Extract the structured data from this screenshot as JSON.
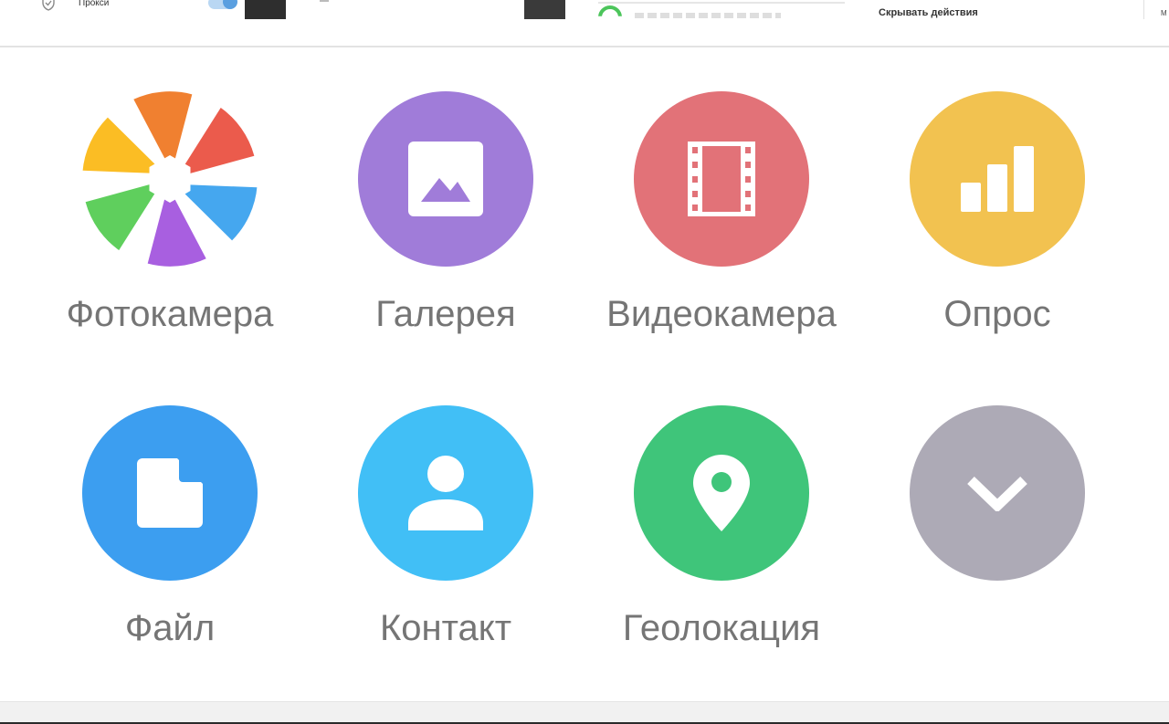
{
  "top_strip": {
    "proxy_label": "Прокси",
    "hide_actions_label": "Скрывать действия",
    "right_fragment": "М"
  },
  "attach_menu": {
    "items": [
      {
        "id": "camera",
        "label": "Фотокамера",
        "icon": "camera-shutter-icon",
        "color": "multicolor"
      },
      {
        "id": "gallery",
        "label": "Галерея",
        "icon": "image-icon",
        "color": "#a07cd9"
      },
      {
        "id": "video",
        "label": "Видеокамера",
        "icon": "film-strip-icon",
        "color": "#e27278"
      },
      {
        "id": "poll",
        "label": "Опрос",
        "icon": "bar-chart-icon",
        "color": "#f2c250"
      },
      {
        "id": "file",
        "label": "Файл",
        "icon": "file-icon",
        "color": "#3c9ef0"
      },
      {
        "id": "contact",
        "label": "Контакт",
        "icon": "person-icon",
        "color": "#41bff6"
      },
      {
        "id": "location",
        "label": "Геолокация",
        "icon": "location-pin-icon",
        "color": "#3fc57a"
      },
      {
        "id": "more",
        "label": "",
        "icon": "chevron-down-icon",
        "color": "#adaab6"
      }
    ]
  }
}
